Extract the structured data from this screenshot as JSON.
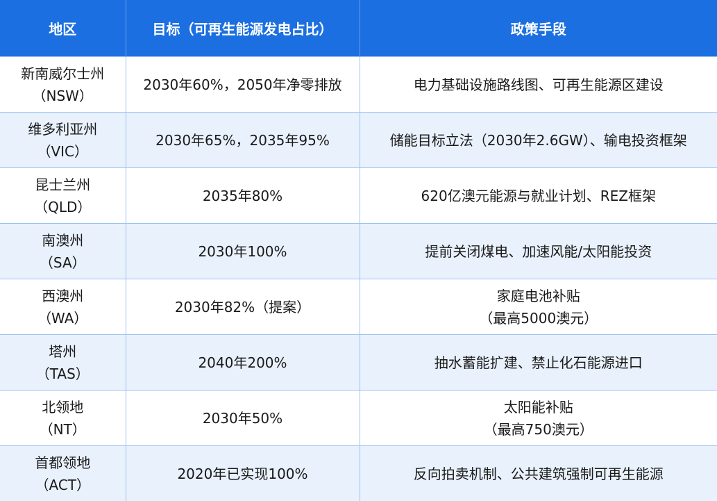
{
  "header": {
    "region": "地区",
    "target": "目标（可再生能源发电占比）",
    "policy": "政策手段"
  },
  "rows": [
    {
      "region_name": "新南威尔士州",
      "region_code": "（NSW）",
      "target": "2030年60%，2050年净零排放",
      "policy_line1": "电力基础设施路线图、可再生能源区建设",
      "policy_line2": ""
    },
    {
      "region_name": "维多利亚州",
      "region_code": "（VIC）",
      "target": "2030年65%，2035年95%",
      "policy_line1": "储能目标立法（2030年2.6GW）、输电投资框架",
      "policy_line2": ""
    },
    {
      "region_name": "昆士兰州",
      "region_code": "（QLD）",
      "target": "2035年80%",
      "policy_line1": "620亿澳元能源与就业计划、REZ框架",
      "policy_line2": ""
    },
    {
      "region_name": "南澳州",
      "region_code": "（SA）",
      "target": "2030年100%",
      "policy_line1": "提前关闭煤电、加速风能/太阳能投资",
      "policy_line2": ""
    },
    {
      "region_name": "西澳州",
      "region_code": "（WA）",
      "target": "2030年82%（提案）",
      "policy_line1": "家庭电池补贴",
      "policy_line2": "（最高5000澳元）"
    },
    {
      "region_name": "塔州",
      "region_code": "（TAS）",
      "target": "2040年200%",
      "policy_line1": "抽水蓄能扩建、禁止化石能源进口",
      "policy_line2": ""
    },
    {
      "region_name": "北领地",
      "region_code": "（NT）",
      "target": "2030年50%",
      "policy_line1": "太阳能补贴",
      "policy_line2": "（最高750澳元）"
    },
    {
      "region_name": "首都领地",
      "region_code": "（ACT）",
      "target": "2020年已实现100%",
      "policy_line1": "反向拍卖机制、公共建筑强制可再生能源",
      "policy_line2": ""
    }
  ]
}
